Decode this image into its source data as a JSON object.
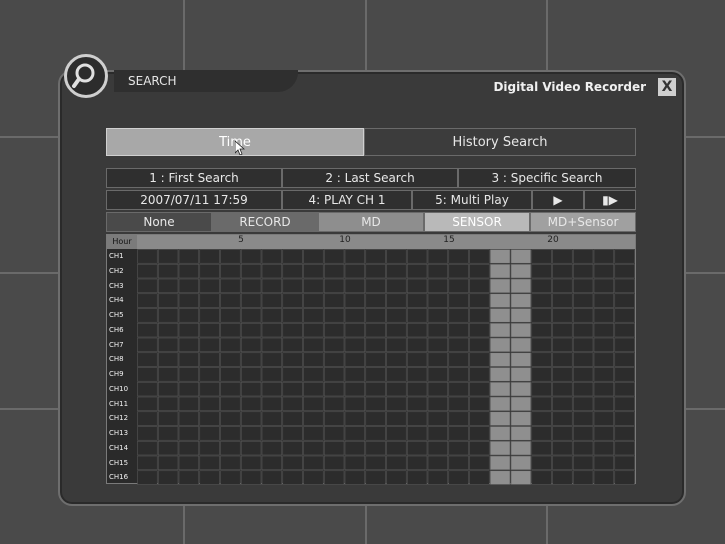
{
  "window": {
    "title_tab": "SEARCH",
    "app_name": "Digital Video Recorder",
    "close_label": "X"
  },
  "tabs": {
    "time": "Time",
    "history": "History Search"
  },
  "search_options": [
    "1 : First Search",
    "2 : Last Search",
    "3 : Specific Search"
  ],
  "row2": {
    "datetime": "2007/07/11  17:59",
    "play_ch": "4: PLAY CH 1",
    "multi_play": "5: Multi Play",
    "play_icon": "▶",
    "next_icon": "▮▶"
  },
  "legend": [
    "None",
    "RECORD",
    "MD",
    "SENSOR",
    "MD+Sensor"
  ],
  "timeline": {
    "hour_label": "Hour",
    "hour_ticks": [
      "5",
      "10",
      "15",
      "20"
    ],
    "channels": [
      "CH1",
      "CH2",
      "CH3",
      "CH4",
      "CH5",
      "CH6",
      "CH7",
      "CH8",
      "CH9",
      "CH10",
      "CH11",
      "CH12",
      "CH13",
      "CH14",
      "CH15",
      "CH16"
    ],
    "highlight_hours": [
      17,
      18
    ]
  },
  "colors": {
    "highlight": "#8f8f8f",
    "cell": "#2c2c2c",
    "cell_border": "#555555"
  }
}
